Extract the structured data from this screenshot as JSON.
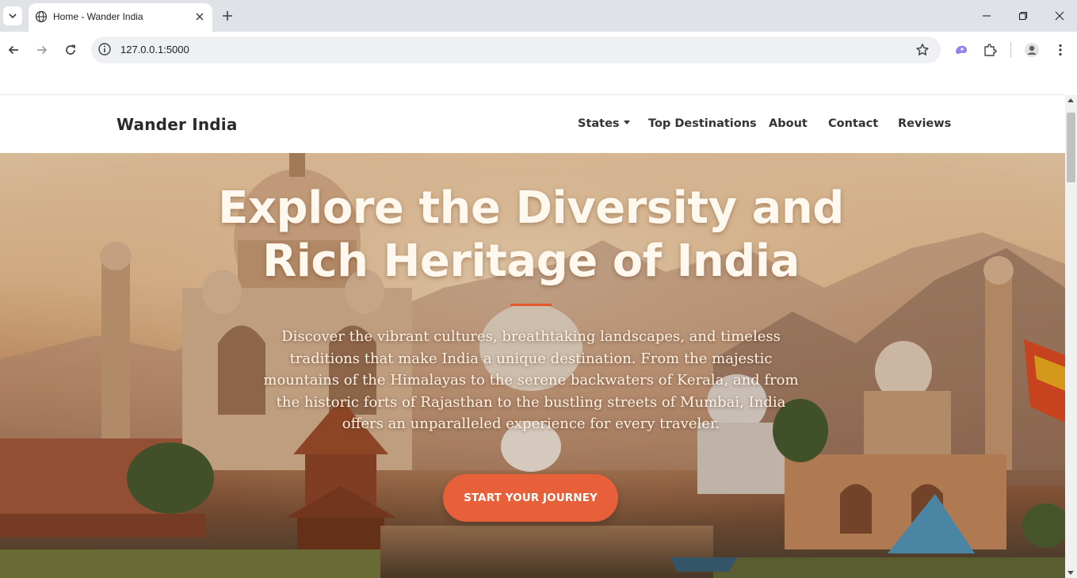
{
  "browser": {
    "tab_title": "Home - Wander India",
    "url": "127.0.0.1:5000"
  },
  "site": {
    "brand": "Wander India",
    "nav": {
      "states": "States",
      "top_destinations": "Top Destinations",
      "about": "About",
      "contact": "Contact",
      "reviews": "Reviews"
    }
  },
  "hero": {
    "title_line1": "Explore the Diversity and",
    "title_line2": "Rich Heritage of India",
    "description": "Discover the vibrant cultures, breathtaking landscapes, and timeless traditions that make India a unique destination. From the majestic mountains of the Himalayas to the serene backwaters of Kerala, and from the historic forts of Rajasthan to the bustling streets of Mumbai, India offers an unparalleled experience for every traveler.",
    "cta_label": "START YOUR JOURNEY"
  },
  "colors": {
    "accent": "#e8603a",
    "rule": "#e2592c",
    "brand_text": "#2a2a2a"
  },
  "icons": [
    "tab-search-icon",
    "globe-icon",
    "close-icon",
    "plus-icon",
    "minimize-icon",
    "restore-icon",
    "window-close-icon",
    "back-icon",
    "forward-icon",
    "reload-icon",
    "info-icon",
    "star-icon",
    "extension-ai-icon",
    "puzzle-icon",
    "profile-icon",
    "menu-dots-icon"
  ]
}
